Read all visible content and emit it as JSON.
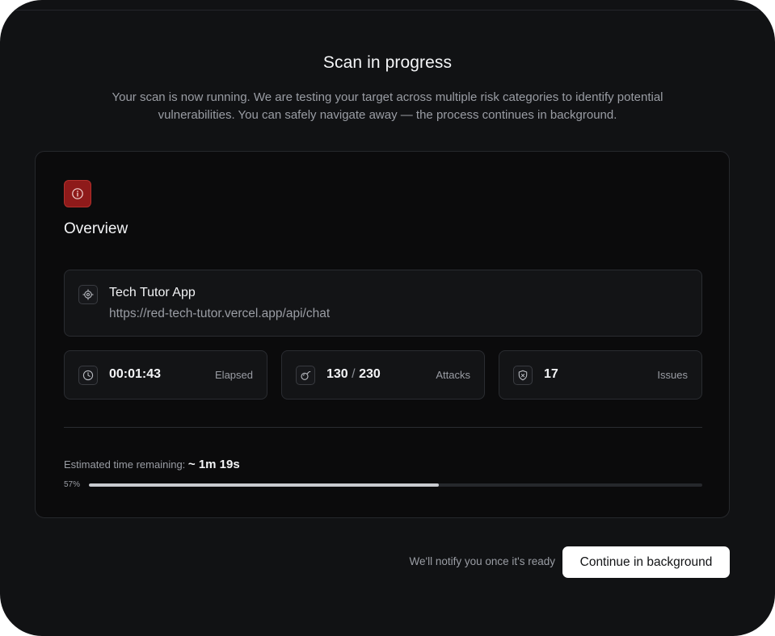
{
  "header": {
    "title": "Scan in progress",
    "subtitle": "Your scan is now running. We are testing your target across multiple risk categories to identify potential vulnerabilities. You can safely navigate away — the process continues in background."
  },
  "overview": {
    "icon": "info-icon",
    "title": "Overview",
    "target": {
      "icon": "target-icon",
      "name": "Tech Tutor App",
      "url": "https://red-tech-tutor.vercel.app/api/chat"
    },
    "stats": {
      "elapsed": {
        "icon": "clock-icon",
        "value": "00:01:43",
        "label": "Elapsed"
      },
      "attacks": {
        "icon": "bomb-icon",
        "done": "130",
        "separator": "/",
        "total": "230",
        "label": "Attacks"
      },
      "issues": {
        "icon": "shield-icon",
        "value": "17",
        "label": "Issues"
      }
    },
    "progress": {
      "eta_label": "Estimated time remaining:",
      "eta_value": "~ 1m 19s",
      "percent_label": "57%",
      "percent": 57
    }
  },
  "footer": {
    "notify_text": "We'll notify you once it's ready",
    "continue_label": "Continue in background"
  },
  "colors": {
    "background": "#111214",
    "card": "#0b0b0c",
    "accent_red": "#8e1a1a",
    "progress_fill": "#c8cacf",
    "button": "#ffffff"
  }
}
